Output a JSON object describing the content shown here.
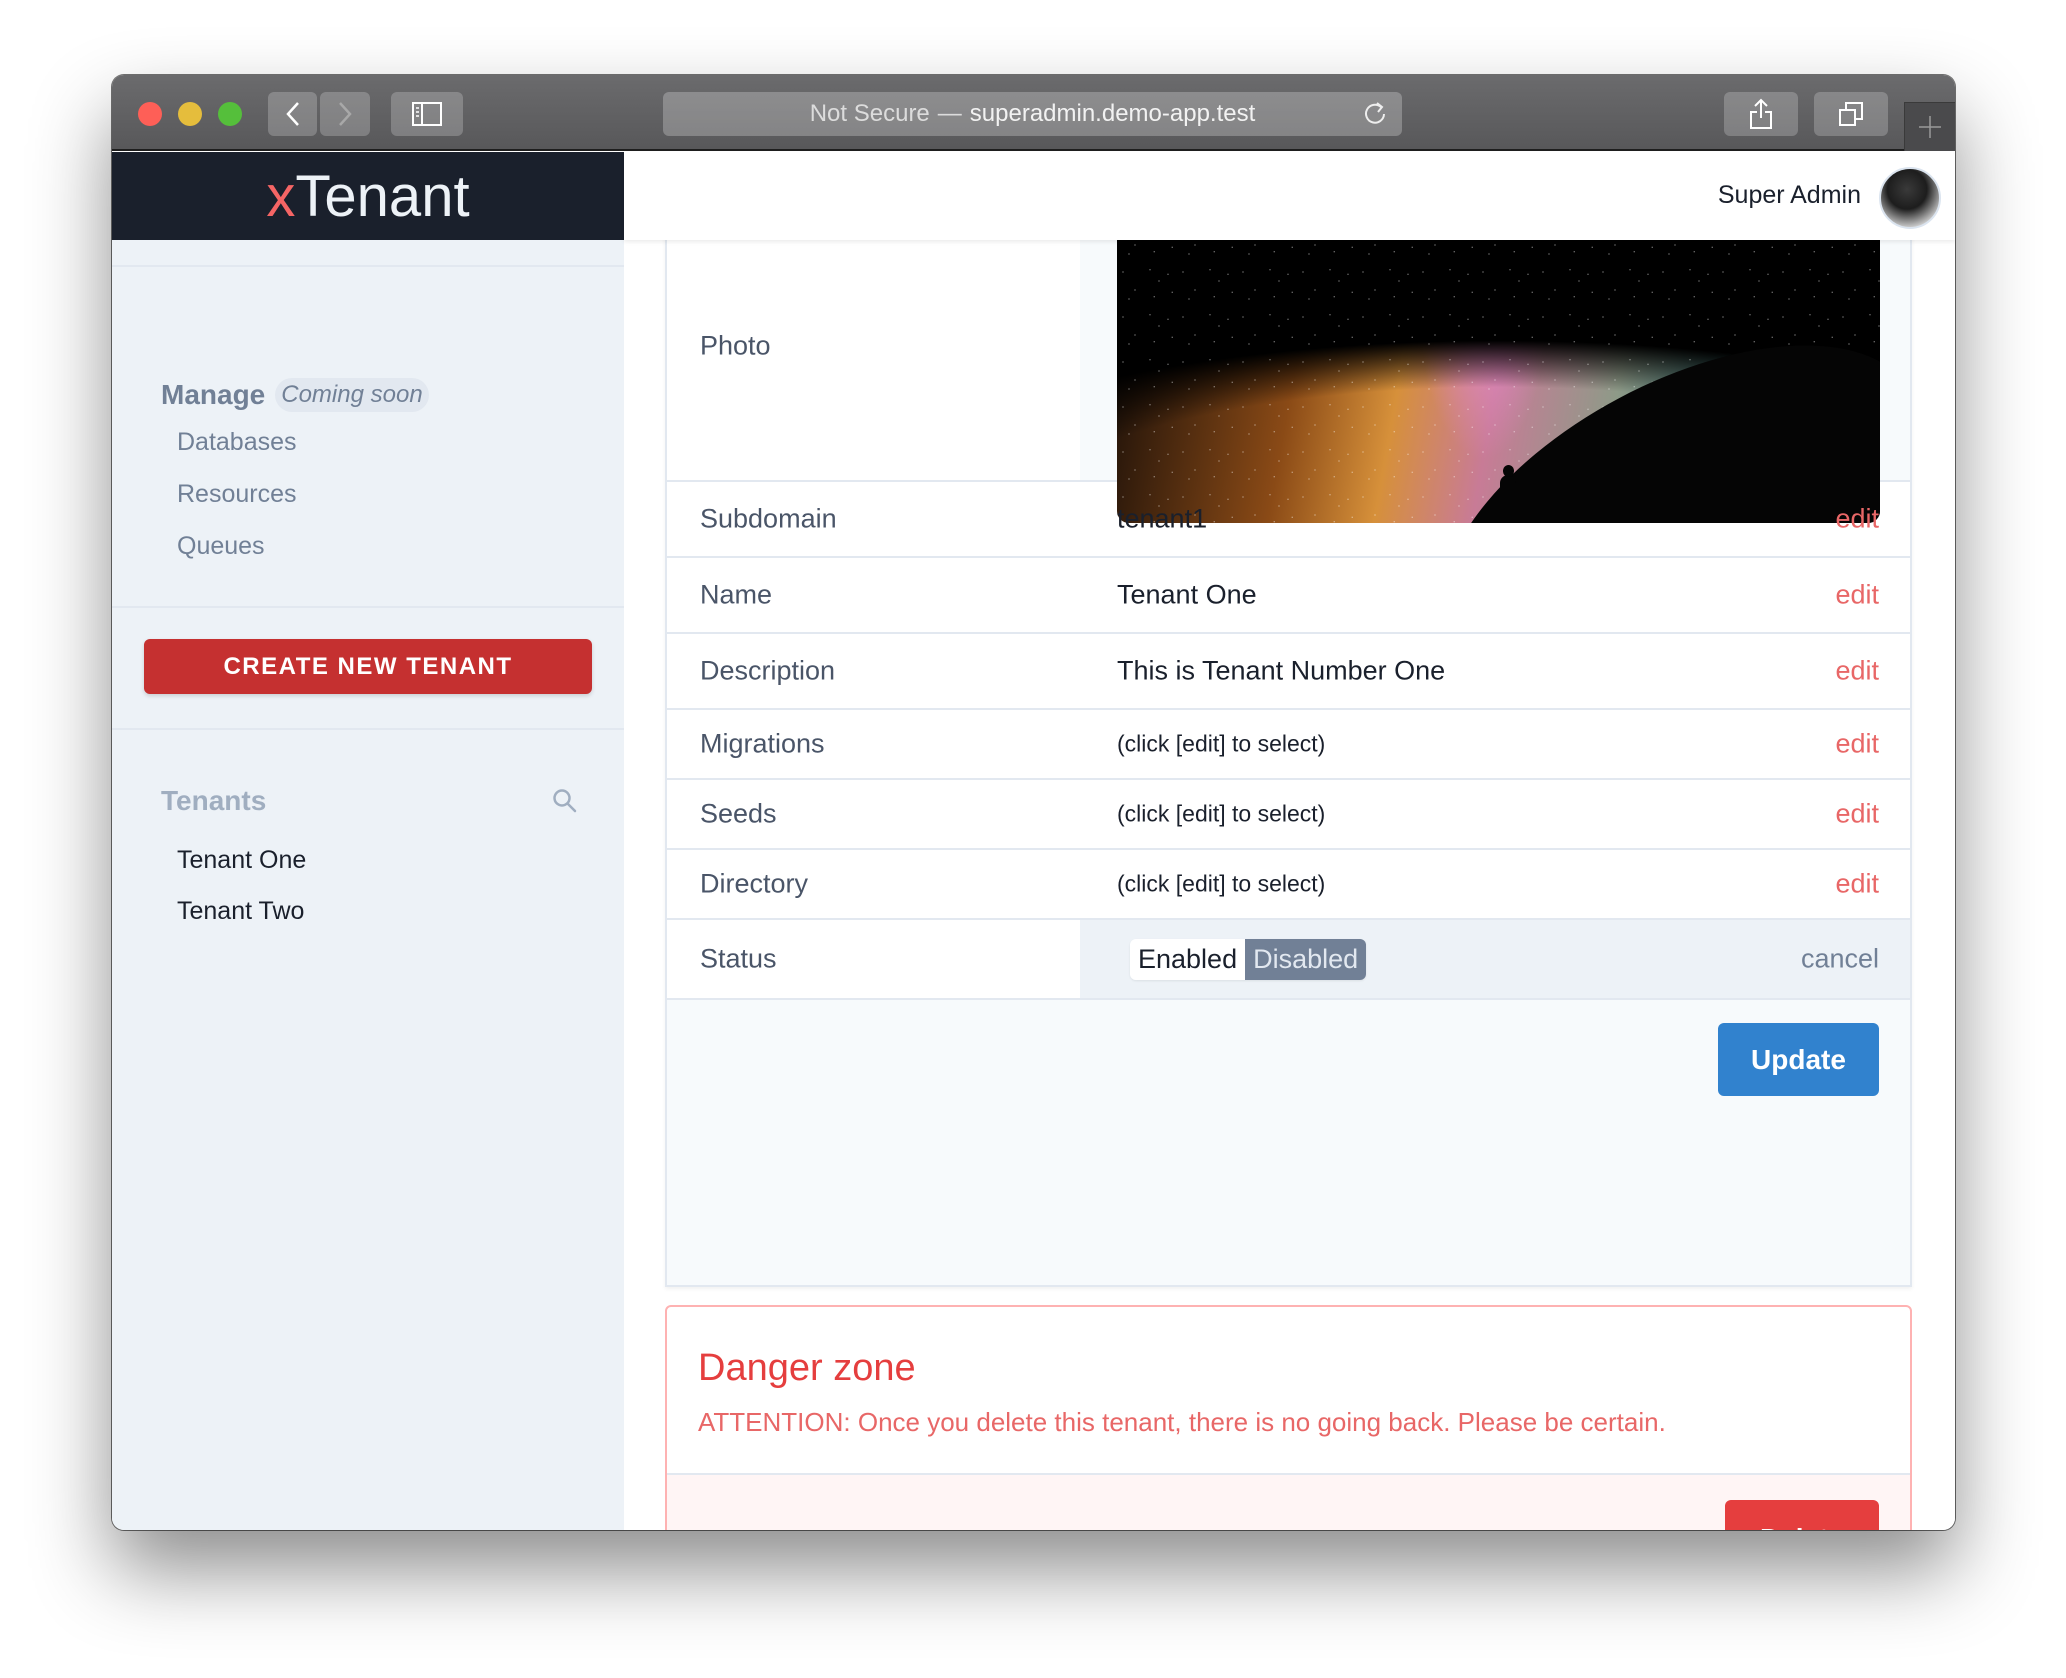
{
  "browser": {
    "security_label": "Not Secure",
    "separator": "—",
    "domain": "superadmin.demo-app.test",
    "buttons": {
      "back": "back-icon",
      "forward": "forward-icon",
      "sidebar": "sidebar-icon",
      "reload": "reload-icon",
      "share": "share-icon",
      "tabs": "tabs-icon",
      "new_tab": "plus-icon"
    }
  },
  "logo": {
    "prefix": "x",
    "name": "Tenant",
    "accent_color": "#f56565"
  },
  "header": {
    "user_name": "Super Admin",
    "avatar": "avatar-photo"
  },
  "sidebar": {
    "manage": {
      "title": "Manage",
      "badge": "Coming soon",
      "items": [
        {
          "label": "Databases"
        },
        {
          "label": "Resources"
        },
        {
          "label": "Queues"
        }
      ]
    },
    "create_button": "CREATE NEW TENANT",
    "tenants": {
      "title": "Tenants",
      "search_icon": "search-icon",
      "items": [
        {
          "label": "Tenant One"
        },
        {
          "label": "Tenant Two"
        }
      ]
    }
  },
  "details": {
    "photo": {
      "label": "Photo",
      "alt": "Starry night sky over silhouetted person"
    },
    "rows": [
      {
        "label": "Subdomain",
        "value": "tenant1",
        "action": "edit"
      },
      {
        "label": "Name",
        "value": "Tenant One",
        "action": "edit"
      },
      {
        "label": "Description",
        "value": "This is Tenant Number One",
        "action": "edit"
      },
      {
        "label": "Migrations",
        "value": "(click [edit] to select)",
        "action": "edit"
      },
      {
        "label": "Seeds",
        "value": "(click [edit] to select)",
        "action": "edit"
      },
      {
        "label": "Directory",
        "value": "(click [edit] to select)",
        "action": "edit"
      }
    ],
    "status": {
      "label": "Status",
      "options": [
        "Enabled",
        "Disabled"
      ],
      "selected": "Disabled",
      "action": "cancel"
    },
    "update_button": "Update"
  },
  "danger_zone": {
    "title": "Danger zone",
    "message": "ATTENTION: Once you delete this tenant, there is no going back. Please be certain.",
    "delete_button": "Delete"
  },
  "colors": {
    "danger": "#e53e3e",
    "primary": "#3182ce",
    "create": "#c53030",
    "toggle_selected": "#718096"
  }
}
